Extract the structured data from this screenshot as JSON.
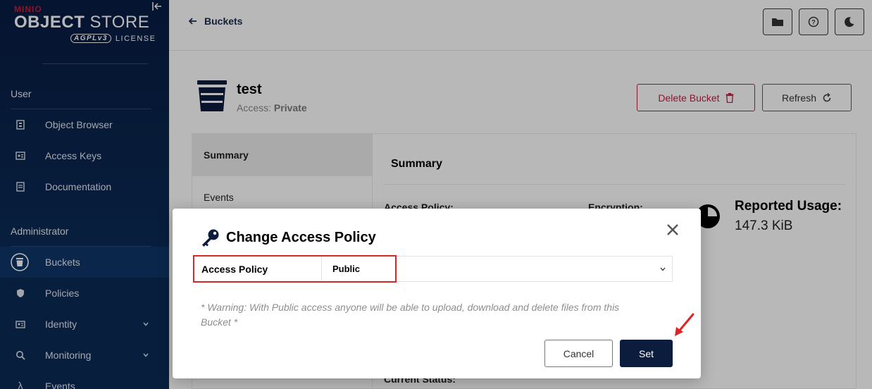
{
  "sidebar": {
    "brand_minio": "MINIO",
    "brand_title_bold": "OBJECT",
    "brand_title_light": "STORE",
    "brand_agpl": "AGPLv3",
    "brand_license": "LICENSE",
    "sections": [
      {
        "label": "User",
        "items": [
          {
            "label": "Object Browser",
            "icon": "object-browser-icon"
          },
          {
            "label": "Access Keys",
            "icon": "access-keys-icon"
          },
          {
            "label": "Documentation",
            "icon": "documentation-icon"
          }
        ]
      },
      {
        "label": "Administrator",
        "items": [
          {
            "label": "Buckets",
            "icon": "buckets-icon",
            "active": true
          },
          {
            "label": "Policies",
            "icon": "policies-icon"
          },
          {
            "label": "Identity",
            "icon": "identity-icon",
            "expandable": true
          },
          {
            "label": "Monitoring",
            "icon": "monitoring-icon",
            "expandable": true
          },
          {
            "label": "Events",
            "icon": "lambda-icon"
          }
        ]
      }
    ]
  },
  "header": {
    "back_label": "Buckets",
    "buttons": [
      "folder-icon",
      "help-icon",
      "dark-mode-icon"
    ]
  },
  "bucket": {
    "name": "test",
    "access_prefix": "Access:",
    "access_value": "Private",
    "delete_label": "Delete Bucket",
    "refresh_label": "Refresh"
  },
  "tabs": [
    {
      "label": "Summary",
      "active": true
    },
    {
      "label": "Events"
    }
  ],
  "summary": {
    "title": "Summary",
    "access_policy_label": "Access Policy:",
    "encryption_label": "Encryption:",
    "current_status_label": "Current Status:",
    "reported_usage_label": "Reported Usage:",
    "reported_usage_value": "147.3 KiB"
  },
  "modal": {
    "title": "Change Access Policy",
    "field_label": "Access Policy",
    "field_value": "Public",
    "warning": "* Warning: With Public access anyone will be able to upload, download and delete files from this Bucket *",
    "cancel_label": "Cancel",
    "set_label": "Set"
  },
  "colors": {
    "sidebar_bg": "#0b2a55",
    "accent_red": "#c51c3f",
    "primary_dark": "#0b1c3d",
    "highlight_red": "#d62828"
  }
}
